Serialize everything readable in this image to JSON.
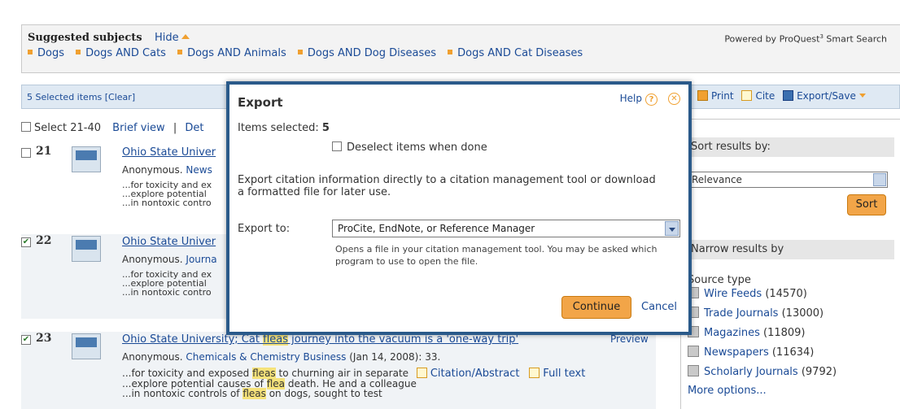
{
  "suggest": {
    "title": "Suggested subjects",
    "hide_label": "Hide",
    "powered_prefix": "Powered by ProQuest",
    "powered_suffix": " Smart Search",
    "subjects": [
      "Dogs",
      "Dogs AND Cats",
      "Dogs AND Animals",
      "Dogs AND Dog Diseases",
      "Dogs AND Cat Diseases"
    ]
  },
  "toolbar": {
    "selected_text": "5 Selected items [Clear]",
    "print_label": "Print",
    "cite_label": "Cite",
    "export_label": "Export/Save"
  },
  "results_header": {
    "select_label": "Select 21-40",
    "brief_view": "Brief view",
    "separator": "|",
    "detailed_view": "Det"
  },
  "results": [
    {
      "num": "21",
      "checked": false,
      "title": "Ohio State Univer",
      "source_prefix": "Anonymous.",
      "source_pub": "News",
      "snippet": [
        "...for toxicity and ex",
        "...explore potential",
        "...in nontoxic contro"
      ]
    },
    {
      "num": "22",
      "checked": true,
      "title": "Ohio State Univer",
      "source_prefix": "Anonymous.",
      "source_pub": "Journa",
      "snippet": [
        "...for toxicity and ex",
        "...explore potential",
        "...in nontoxic contro"
      ]
    },
    {
      "num": "23",
      "checked": true,
      "title_a": "Ohio State University; Cat ",
      "title_hl": "fleas",
      "title_b": " journey into the vacuum is a 'one-way trip'",
      "preview": "Preview",
      "source_prefix": "Anonymous.",
      "source_pub": "Chemicals & Chemistry Business",
      "source_rest": " (Jan 14, 2008): 33.",
      "snip1_a": "...for toxicity and exposed ",
      "snip1_hl": "fleas",
      "snip1_b": " to churning air in separate",
      "snip2_a": "...explore potential causes of ",
      "snip2_hl": "flea",
      "snip2_b": " death. He and a colleague",
      "snip3_a": "...in nontoxic controls of ",
      "snip3_hl": "fleas",
      "snip3_b": " on dogs, sought to test",
      "citation_label": "Citation/Abstract",
      "fulltext_label": "Full text"
    }
  ],
  "sidebar": {
    "sort_header": "Sort results by:",
    "sort_value": "Relevance",
    "sort_button": "Sort",
    "narrow_header": "Narrow results by",
    "source_type_label": "Source type",
    "facets": [
      {
        "label": "Wire Feeds",
        "count": "(14570)"
      },
      {
        "label": "Trade Journals",
        "count": "(13000)"
      },
      {
        "label": "Magazines",
        "count": "(11809)"
      },
      {
        "label": "Newspapers",
        "count": "(11634)"
      },
      {
        "label": "Scholarly Journals",
        "count": "(9792)"
      }
    ],
    "more_options": "More options..."
  },
  "dialog": {
    "title": "Export",
    "help_label": "Help",
    "items_selected_label": "Items selected:",
    "items_selected_count": "5",
    "deselect_label": "Deselect items when done",
    "explanation": "Export citation information directly to a citation management tool or download a formatted file for later use.",
    "export_to_label": "Export to:",
    "export_to_value": "ProCite, EndNote, or Reference Manager",
    "export_hint": "Opens a file in your citation management tool. You may be asked which program to use to open the file.",
    "continue_label": "Continue",
    "cancel_label": "Cancel"
  }
}
